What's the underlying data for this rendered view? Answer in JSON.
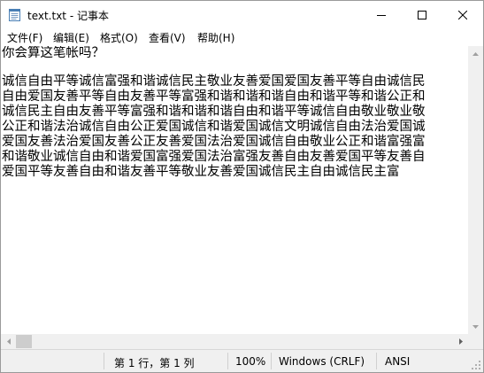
{
  "window": {
    "title": "text.txt - 记事本"
  },
  "menu": {
    "items": [
      "文件(F)",
      "编辑(E)",
      "格式(O)",
      "查看(V)",
      "帮助(H)"
    ]
  },
  "editor": {
    "lines": [
      "你会算这笔帐吗？",
      "",
      "诚信自由平等诚信富强和谐诚信民主敬业友善爱国爱国友善平等自由诚信民",
      "自由爱国友善平等自由友善平等富强和谐和谐和谐自由和谐平等和谐公正和",
      "诚信民主自由友善平等富强和谐和谐和谐自由和谐平等诚信自由敬业敬业敬",
      "公正和谐法治诚信自由公正爱国诚信和谐爱国诚信文明诚信自由法治爱国诚",
      "爱国友善法治爱国友善公正友善爱国法治爱国诚信自由敬业公正和谐富强富",
      "和谐敬业诚信自由和谐爱国富强爱国法治富强友善自由友善爱国平等友善自",
      "爱国平等友善自由和谐友善平等敬业友善爱国诚信民主自由诚信民主富"
    ]
  },
  "statusbar": {
    "position": "第 1 行，第 1 列",
    "zoom": "100%",
    "line_ending": "Windows (CRLF)",
    "encoding": "ANSI"
  },
  "icons": {
    "app": "notepad-icon",
    "minimize": "minimize-icon",
    "maximize": "maximize-icon",
    "close": "close-icon"
  }
}
